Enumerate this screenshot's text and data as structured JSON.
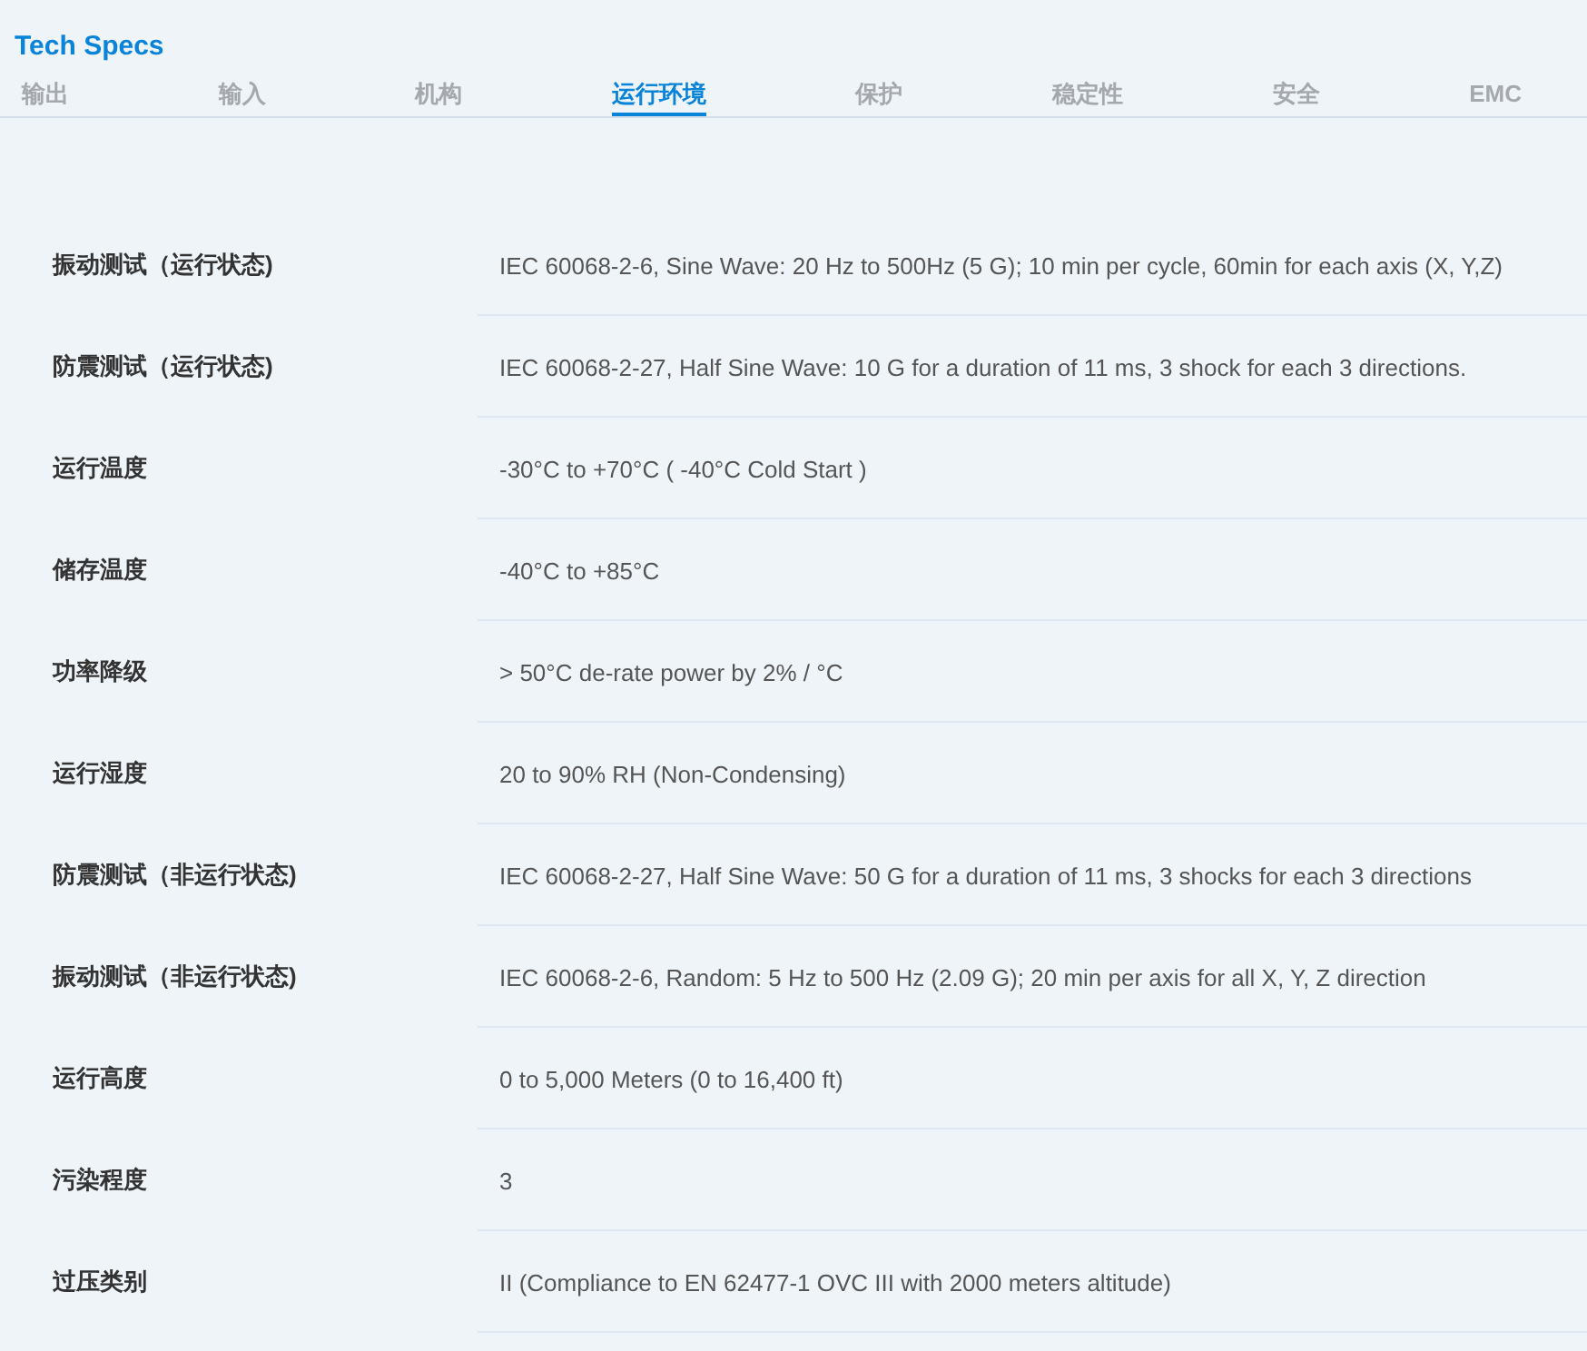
{
  "title": "Tech Specs",
  "tabs": [
    {
      "label": "输出",
      "selected": false
    },
    {
      "label": "输入",
      "selected": false
    },
    {
      "label": "机构",
      "selected": false
    },
    {
      "label": "运行环境",
      "selected": true
    },
    {
      "label": "保护",
      "selected": false
    },
    {
      "label": "稳定性",
      "selected": false
    },
    {
      "label": "安全",
      "selected": false
    },
    {
      "label": "EMC",
      "selected": false
    }
  ],
  "specs": [
    {
      "name": "振动测试（运行状态)",
      "value": "IEC 60068-2-6, Sine Wave: 20 Hz to 500Hz (5 G); 10 min per cycle, 60min for each axis (X, Y,Z)"
    },
    {
      "name": "防震测试（运行状态)",
      "value": "IEC 60068-2-27, Half Sine Wave: 10 G for a duration of 11 ms, 3 shock for each 3 directions."
    },
    {
      "name": "运行温度",
      "value": "-30°C to +70°C ( -40°C Cold Start )"
    },
    {
      "name": "储存温度",
      "value": "-40°C to +85°C"
    },
    {
      "name": "功率降级",
      "value": "> 50°C de-rate power by 2% / °C"
    },
    {
      "name": "运行湿度",
      "value": "20 to 90% RH (Non-Condensing)"
    },
    {
      "name": "防震测试（非运行状态)",
      "value": "IEC 60068-2-27, Half Sine Wave: 50 G for a duration of 11 ms, 3 shocks for each 3 directions"
    },
    {
      "name": "振动测试（非运行状态)",
      "value": "IEC 60068-2-6, Random: 5 Hz to 500 Hz (2.09 G); 20 min per axis for all X, Y, Z direction"
    },
    {
      "name": "运行高度",
      "value": "0 to 5,000 Meters (0 to 16,400 ft)"
    },
    {
      "name": "污染程度",
      "value": "3"
    },
    {
      "name": "过压类别",
      "value": "II (Compliance to EN 62477-1 OVC III with 2000 meters altitude)"
    }
  ]
}
